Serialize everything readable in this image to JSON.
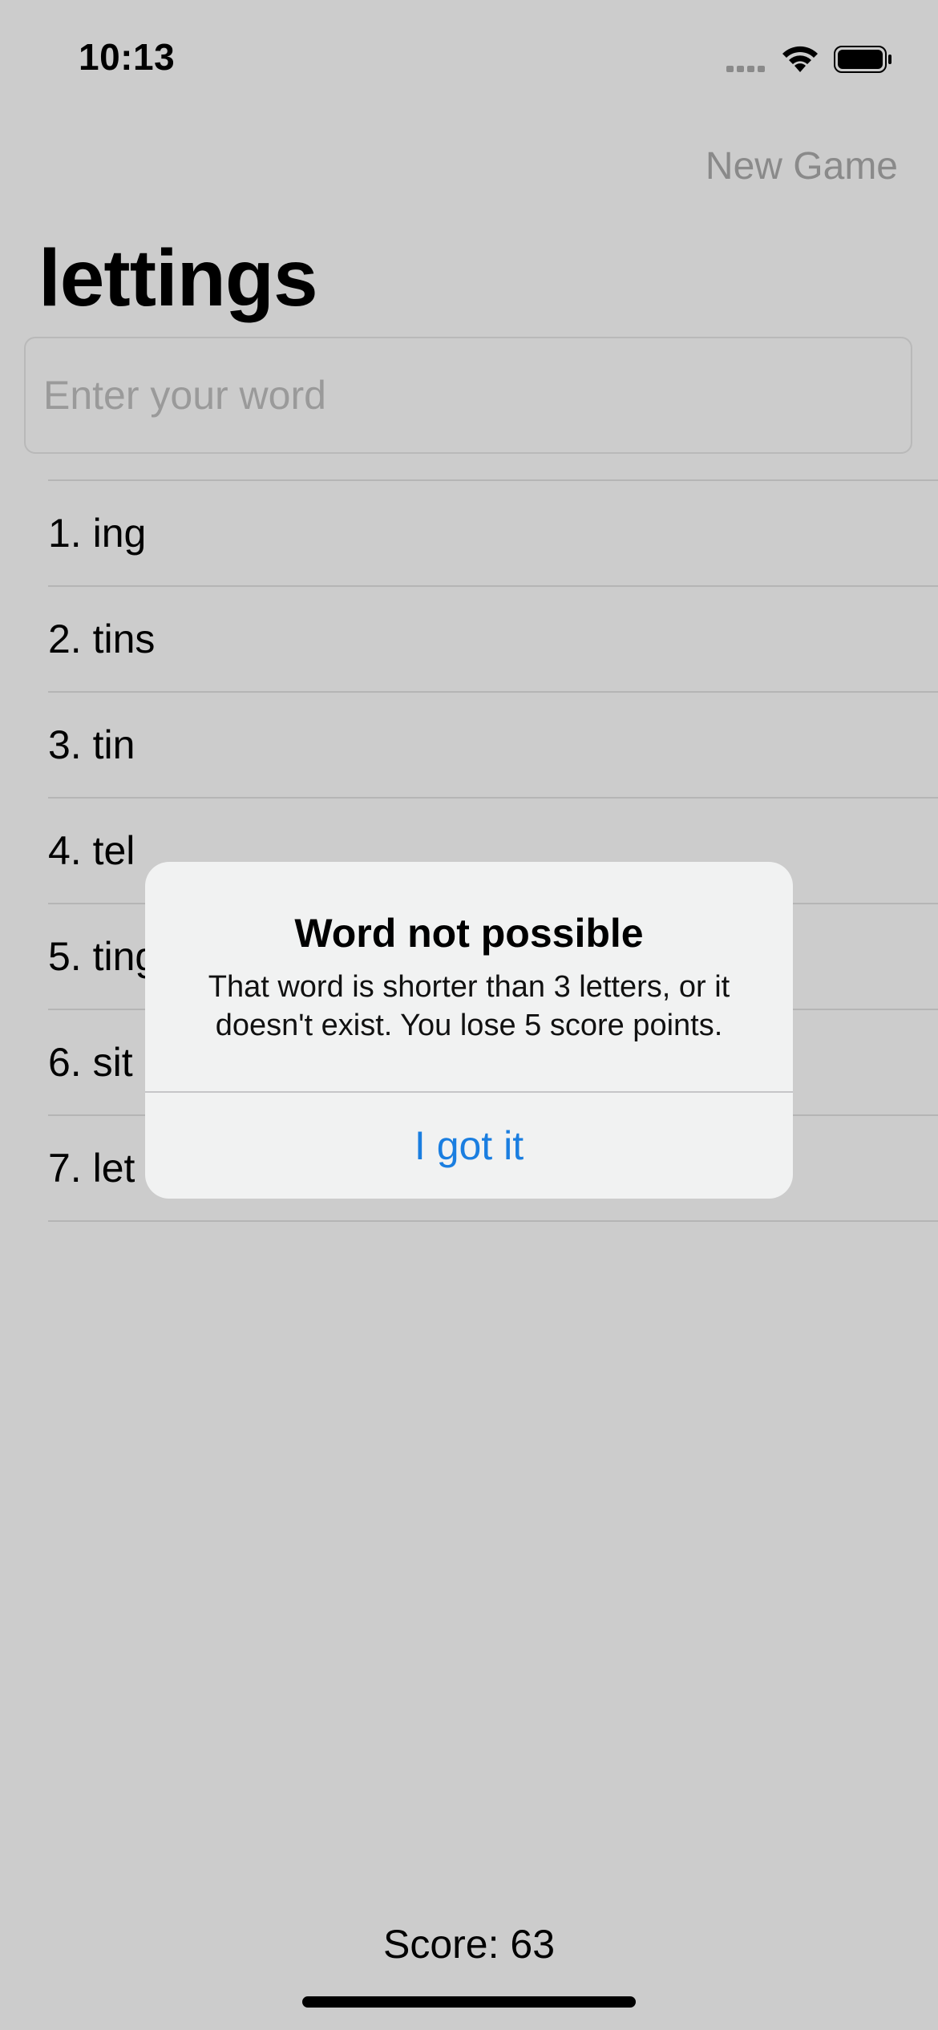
{
  "status_bar": {
    "time": "10:13"
  },
  "nav": {
    "new_game_label": "New Game"
  },
  "title": "lettings",
  "input": {
    "placeholder": "Enter your word",
    "value": ""
  },
  "words": [
    "1. ing",
    "2. tins",
    "3. tin",
    "4. tel",
    "5. ting",
    "6. sit",
    "7. let"
  ],
  "alert": {
    "title": "Word not possible",
    "message": "That word is shorter than 3 letters, or it doesn't exist. You lose 5 score points.",
    "button_label": "I got it"
  },
  "score": "Score: 63",
  "colors": {
    "background": "#cccccc",
    "accent": "#1a7ee0",
    "alert_background": "#f1f2f2"
  }
}
